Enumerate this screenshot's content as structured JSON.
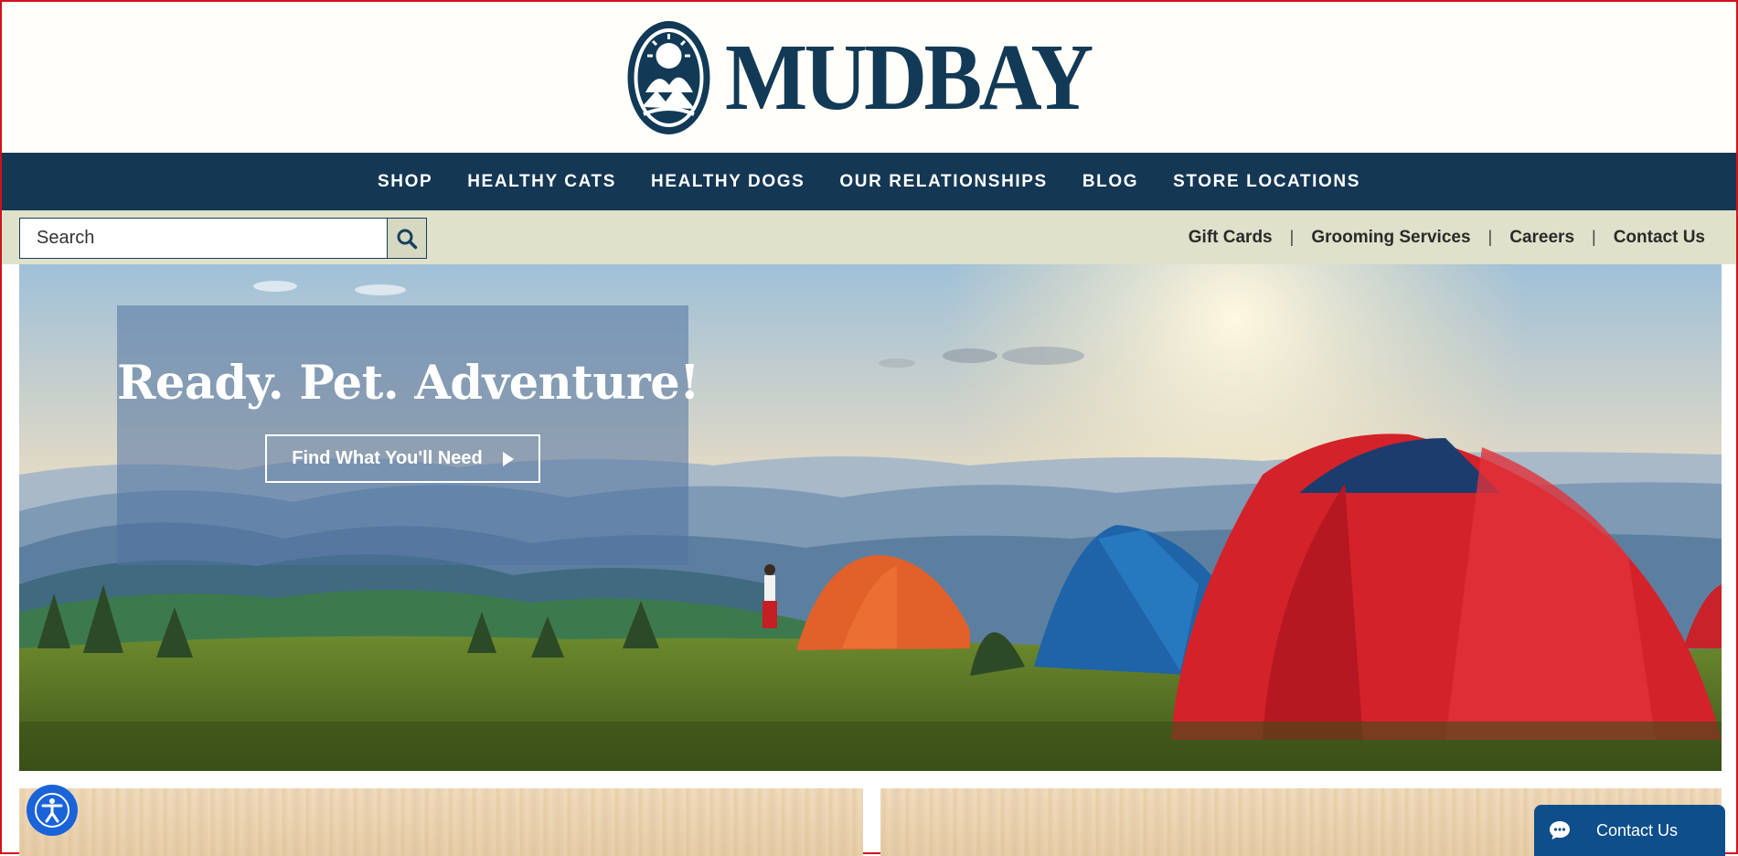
{
  "brand": {
    "logo_text": "MUDBAY",
    "logo_icon": "mudbay-emblem-icon",
    "color_primary": "#143754",
    "color_utility_bar": "#dfe1ca"
  },
  "main_nav": {
    "items": [
      {
        "label": "SHOP"
      },
      {
        "label": "HEALTHY CATS"
      },
      {
        "label": "HEALTHY DOGS"
      },
      {
        "label": "OUR RELATIONSHIPS"
      },
      {
        "label": "BLOG"
      },
      {
        "label": "STORE LOCATIONS"
      }
    ]
  },
  "search": {
    "placeholder": "Search",
    "icon": "search-icon"
  },
  "utility_links": {
    "items": [
      {
        "label": "Gift Cards"
      },
      {
        "label": "Grooming Services"
      },
      {
        "label": "Careers"
      },
      {
        "label": "Contact Us"
      }
    ],
    "separator": "|"
  },
  "hero": {
    "title": "Ready. Pet. Adventure!",
    "cta_label": "Find What You'll Need",
    "cta_icon": "play-arrow-icon"
  },
  "accessibility": {
    "icon": "accessibility-icon"
  },
  "chat": {
    "label": "Contact Us",
    "icon": "chat-bubble-icon",
    "color": "#0d4e8b"
  }
}
